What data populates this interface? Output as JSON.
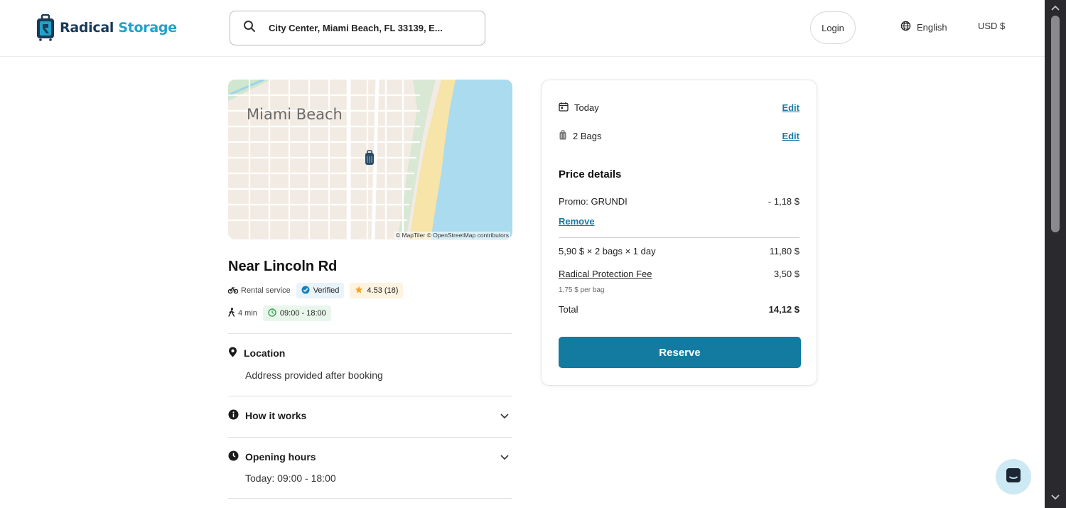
{
  "header": {
    "logo_part1": "Radical",
    "logo_part2": "Storage",
    "search_value": "City Center, Miami Beach, FL 33139, E...",
    "login_label": "Login",
    "language": "English",
    "currency": "USD $"
  },
  "map": {
    "city_label": "Miami Beach",
    "credit": "© MapTiler © OpenStreetMap contributors"
  },
  "listing": {
    "title": "Near Lincoln Rd",
    "service": "Rental service",
    "verified": "Verified",
    "rating": "4.53 (18)",
    "walk_time": "4 min",
    "hours": "09:00 - 18:00"
  },
  "sections": {
    "location_title": "Location",
    "location_body": "Address provided after booking",
    "how_title": "How it works",
    "hours_title": "Opening hours",
    "hours_body": "Today: 09:00 - 18:00"
  },
  "booking": {
    "date_label": "Today",
    "bags_label": "2 Bags",
    "edit_label": "Edit",
    "price_details_title": "Price details",
    "promo_label": "Promo: GRUNDI",
    "promo_value": "- 1,18 $",
    "remove_label": "Remove",
    "line_label": "5,90 $ × 2 bags × 1 day",
    "line_value": "11,80 $",
    "fee_label": "Radical Protection Fee",
    "fee_value": "3,50 $",
    "fee_sub": "1,75 $ per bag",
    "total_label": "Total",
    "total_value": "14,12 $",
    "reserve_label": "Reserve"
  },
  "colors": {
    "brand_dark": "#1a3a57",
    "brand_light": "#1fa3c9",
    "primary_button": "#137aa0",
    "link": "#1978a0"
  }
}
